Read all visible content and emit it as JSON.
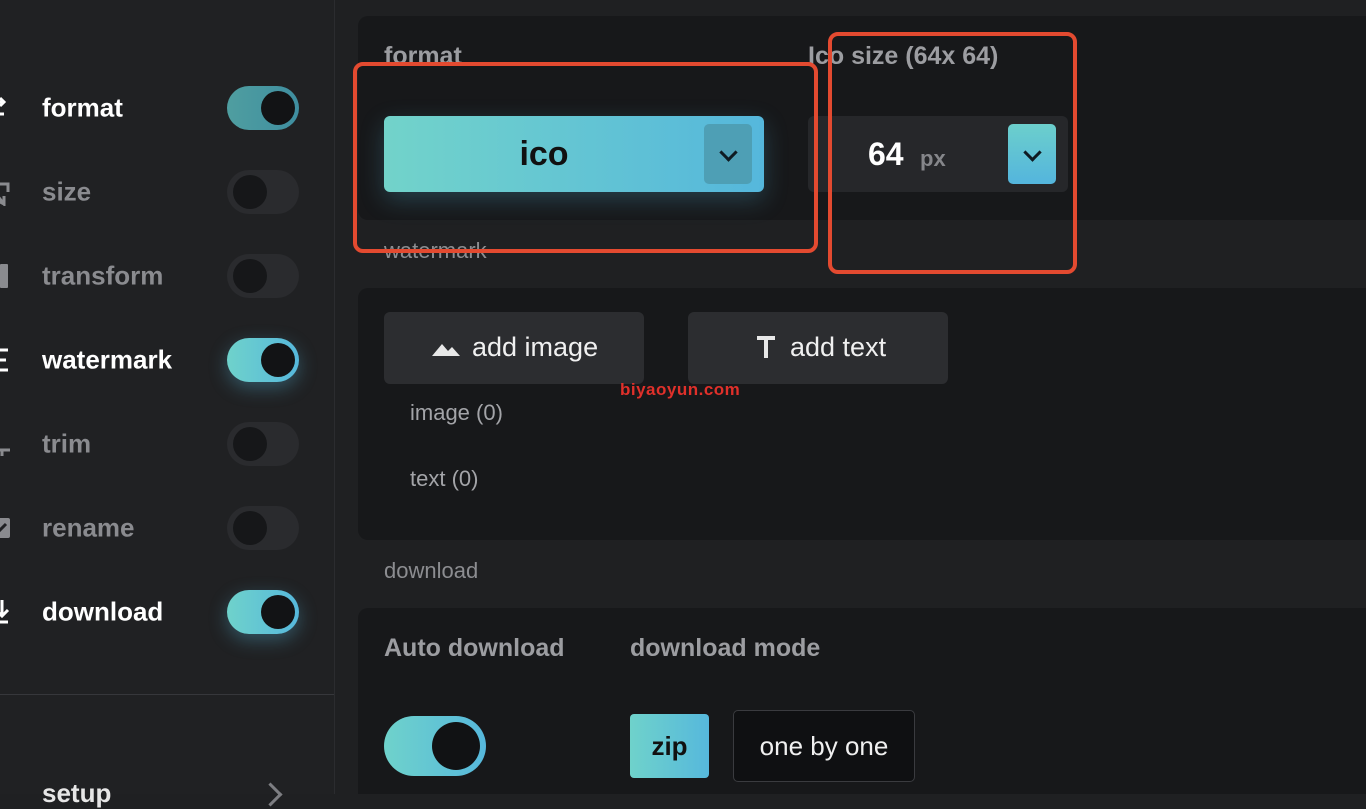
{
  "sidebar": {
    "items": [
      {
        "label": "format",
        "on": true
      },
      {
        "label": "size",
        "on": false
      },
      {
        "label": "transform",
        "on": false
      },
      {
        "label": "watermark",
        "on": true
      },
      {
        "label": "trim",
        "on": false
      },
      {
        "label": "rename",
        "on": false
      },
      {
        "label": "download",
        "on": true
      }
    ],
    "setup_label": "setup"
  },
  "format_section": {
    "format_title": "format",
    "format_value": "ico",
    "size_title": "Ico size (64x 64)",
    "size_value": "64",
    "size_unit": "px"
  },
  "watermark_section": {
    "title": "watermark",
    "add_image_label": "add image",
    "add_text_label": "add text",
    "image_count": "image (0)",
    "text_count": "text (0)"
  },
  "download_section": {
    "title": "download",
    "auto_download_title": "Auto download",
    "auto_download_on": true,
    "mode_title": "download mode",
    "mode_zip": "zip",
    "mode_one_by_one": "one by one"
  },
  "overlay_watermark": "biyaoyun.com",
  "colors": {
    "accent_start": "#72d3ca",
    "accent_end": "#55b7dc",
    "highlight": "#e34a30"
  }
}
